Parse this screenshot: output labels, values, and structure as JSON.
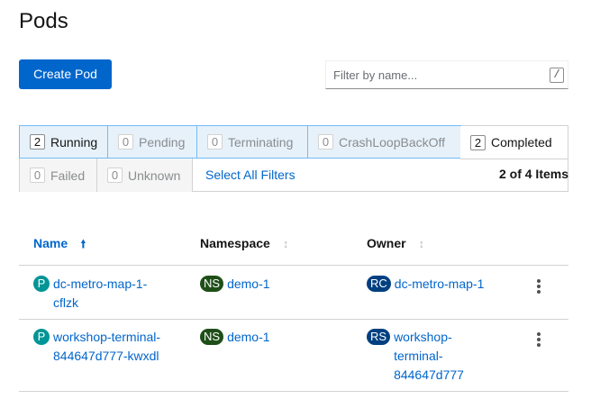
{
  "page": {
    "title": "Pods"
  },
  "toolbar": {
    "create_label": "Create Pod",
    "filter_placeholder": "Filter by name...",
    "filter_shortcut": "/"
  },
  "filters": {
    "running": {
      "count": "2",
      "label": "Running",
      "selected": true
    },
    "pending": {
      "count": "0",
      "label": "Pending",
      "selected": true
    },
    "terminating": {
      "count": "0",
      "label": "Terminating",
      "selected": true
    },
    "crashloop": {
      "count": "0",
      "label": "CrashLoopBackOff",
      "selected": true
    },
    "completed": {
      "count": "2",
      "label": "Completed",
      "selected": false
    },
    "failed": {
      "count": "0",
      "label": "Failed",
      "selected": false
    },
    "unknown": {
      "count": "0",
      "label": "Unknown",
      "selected": false
    },
    "select_all_label": "Select All Filters",
    "item_count": "2 of 4 Items"
  },
  "table": {
    "headers": {
      "name": "Name",
      "namespace": "Namespace",
      "owner": "Owner"
    },
    "sort_column": "name",
    "sort_direction": "ascending",
    "rows": [
      {
        "name_badge": "P",
        "name_lines": [
          "dc-metro-map-1-",
          "cflzk"
        ],
        "ns_badge": "NS",
        "namespace": "demo-1",
        "owner_badge": "RC",
        "owner_lines": [
          "dc-metro-map-1"
        ]
      },
      {
        "name_badge": "P",
        "name_lines": [
          "workshop-terminal-",
          "844647d777-kwxdl"
        ],
        "ns_badge": "NS",
        "namespace": "demo-1",
        "owner_badge": "RS",
        "owner_lines": [
          "workshop-",
          "terminal-",
          "844647d777"
        ]
      }
    ]
  },
  "colors": {
    "primary": "#0066cc",
    "pod_badge": "#009596",
    "namespace_badge": "#1e4f18",
    "owner_badge": "#004080",
    "filter_selected_bg": "#e7f1fa"
  }
}
